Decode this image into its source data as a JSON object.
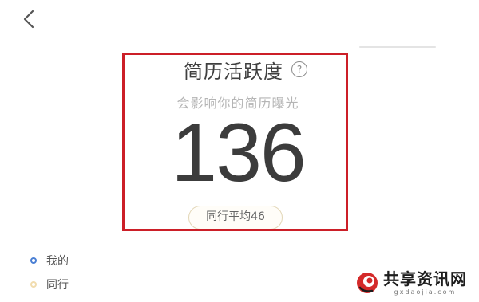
{
  "header": {
    "back_icon": "chevron-left-icon"
  },
  "activity": {
    "title": "简历活跃度",
    "help_icon_text": "?",
    "subtitle": "会影响你的简历曝光",
    "score": "136",
    "peer_average": "同行平均46"
  },
  "legend": {
    "items": [
      {
        "label": "我的",
        "color": "#4a7fd4"
      },
      {
        "label": "同行",
        "color": "#f1dcae"
      }
    ]
  },
  "watermark": {
    "name": "共享资讯网",
    "domain": "gxdaojia.com"
  },
  "colors": {
    "highlight_border": "#cc1f28",
    "score_text": "#3c3c3c"
  }
}
